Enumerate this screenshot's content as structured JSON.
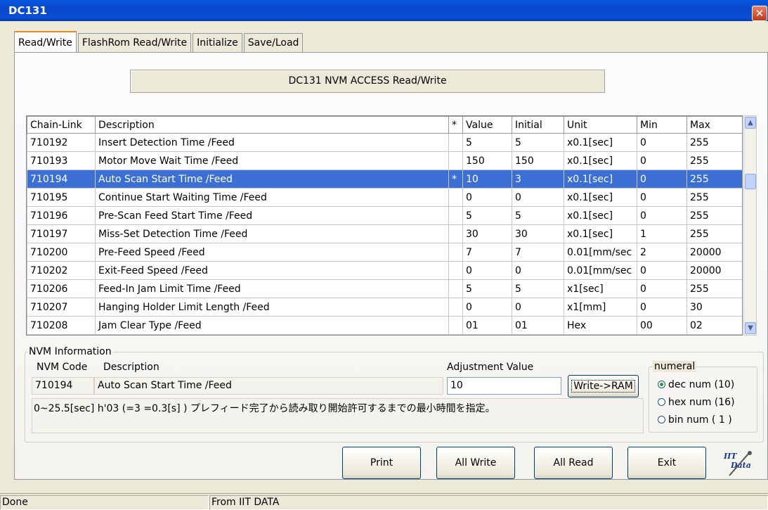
{
  "window": {
    "title": "DC131",
    "close_glyph": "✕"
  },
  "tabs": [
    "Read/Write",
    "FlashRom Read/Write",
    "Initialize",
    "Save/Load"
  ],
  "header_button": "DC131 NVM ACCESS Read/Write",
  "table": {
    "columns": [
      "Chain-Link",
      "Description",
      "*",
      "Value",
      "Initial",
      "Unit",
      "Min",
      "Max"
    ],
    "rows": [
      [
        "710192",
        "Insert Detection Time /Feed",
        "",
        "5",
        "5",
        "x0.1[sec]",
        "0",
        "255"
      ],
      [
        "710193",
        "Motor Move Wait Time /Feed",
        "",
        "150",
        "150",
        "x0.1[sec]",
        "0",
        "255"
      ],
      [
        "710194",
        "Auto Scan Start Time /Feed",
        "*",
        "10",
        "3",
        "x0.1[sec]",
        "0",
        "255"
      ],
      [
        "710195",
        "Continue Start Waiting Time /Feed",
        "",
        "0",
        "0",
        "x0.1[sec]",
        "0",
        "255"
      ],
      [
        "710196",
        "Pre-Scan Feed Start Time /Feed",
        "",
        "5",
        "5",
        "x0.1[sec]",
        "0",
        "255"
      ],
      [
        "710197",
        "Miss-Set Detection Time /Feed",
        "",
        "30",
        "30",
        "x0.1[sec]",
        "1",
        "255"
      ],
      [
        "710200",
        "Pre-Feed Speed /Feed",
        "",
        "7",
        "7",
        "0.01[mm/sec",
        "2",
        "20000"
      ],
      [
        "710202",
        "Exit-Feed Speed /Feed",
        "",
        "0",
        "0",
        "0.01[mm/sec",
        "0",
        "20000"
      ],
      [
        "710206",
        "Feed-In Jam Limit Time /Feed",
        "",
        "5",
        "5",
        "x1[sec]",
        "0",
        "255"
      ],
      [
        "710207",
        "Hanging Holder Limit Length /Feed",
        "",
        "0",
        "0",
        "x1[mm]",
        "0",
        "30"
      ],
      [
        "710208",
        "Jam Clear Type /Feed",
        "",
        "01",
        "01",
        "Hex",
        "00",
        "02"
      ]
    ],
    "selected_index": 2
  },
  "nvm": {
    "legend": "NVM Information",
    "code_label": "NVM Code",
    "desc_label": "Description",
    "adj_label": "Adjustment Value",
    "code": "710194",
    "description": "Auto Scan Start Time /Feed",
    "adjustment_value": "10",
    "write_button": "Write->RAM",
    "info": "0~25.5[sec] h'03 (=3 =0.3[s] ) プレフィード完了から読み取り開始許可するまでの最小時間を指定。"
  },
  "numeral": {
    "legend": "numeral",
    "options": [
      "dec num (10)",
      "hex num (16)",
      "bin num  ( 1 )"
    ],
    "selected": 0
  },
  "buttons": {
    "print": "Print",
    "all_write": "All Write",
    "all_read": "All Read",
    "exit": "Exit"
  },
  "logo": {
    "line1": "IIT",
    "line2": "Data"
  },
  "status": {
    "left": "Done",
    "right": "From IIT DATA"
  }
}
